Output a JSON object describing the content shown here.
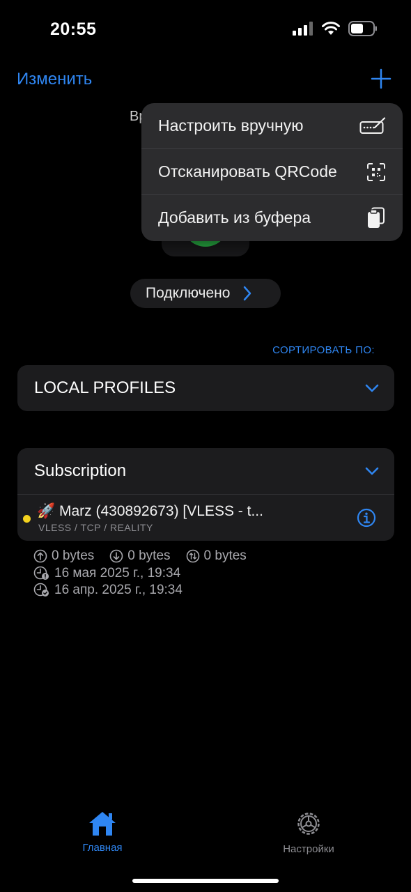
{
  "status_bar": {
    "time": "20:55"
  },
  "nav": {
    "edit_label": "Изменить",
    "background_text": "Вр"
  },
  "menu": {
    "items": [
      {
        "label": "Настроить вручную",
        "icon": "manual-edit-icon"
      },
      {
        "label": "Отсканировать QRCode",
        "icon": "qrcode-scan-icon"
      },
      {
        "label": "Добавить из буфера",
        "icon": "clipboard-icon"
      }
    ]
  },
  "connection": {
    "status_label": "Подключено"
  },
  "sort": {
    "label": "СОРТИРОВАТЬ ПО:"
  },
  "groups": {
    "local": {
      "title": "LOCAL PROFILES"
    },
    "subscription": {
      "title": "Subscription",
      "profile": {
        "emoji": "🚀",
        "name": "Marz (430892673) [VLESS - t...",
        "protocol": "VLESS / TCP / REALITY",
        "status_color": "#f4d21e"
      }
    }
  },
  "stats": {
    "upload": "0 bytes",
    "download": "0 bytes",
    "total": "0 bytes",
    "expires": "16 мая 2025 г., 19:34",
    "updated": "16 апр. 2025 г., 19:34"
  },
  "tabbar": {
    "home_label": "Главная",
    "settings_label": "Настройки"
  },
  "colors": {
    "accent": "#2f86f2",
    "background": "#000000",
    "card": "#1c1c1e",
    "menu": "#2c2c2e",
    "connected_green": "#2fc94e"
  }
}
